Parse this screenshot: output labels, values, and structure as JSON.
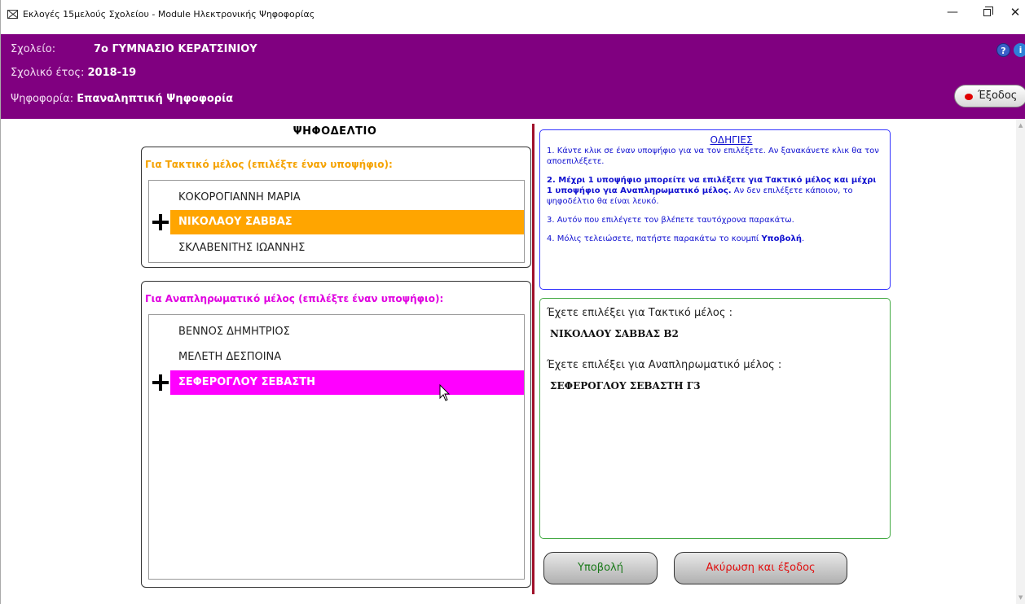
{
  "window": {
    "title": "Εκλογές 15μελούς Σχολείου - Module Ηλεκτρονικής Ψηφοφορίας",
    "minimize_icon": "minimize-icon",
    "maximize_icon": "restore-icon",
    "close_icon": "close-icon"
  },
  "header": {
    "school_label": "Σχολείο:",
    "school_value": "7ο ΓΥΜΝΑΣΙΟ ΚΕΡΑΤΣΙΝΙΟΥ",
    "year_label": "Σχολικό έτος:",
    "year_value": "2018-19",
    "vote_label": "Ψηφοφορία:",
    "vote_value": "Επαναληπτική Ψηφοφορία",
    "help_glyph": "?",
    "info_glyph": "i",
    "exit_label": "Έξοδος",
    "background_color": "#800080"
  },
  "ballot": {
    "title": "ΨΗΦΟΔΕΛΤΙΟ",
    "regular": {
      "heading": "Για Τακτικό μέλος (επιλέξτε έναν υποψήφιο):",
      "heading_color": "#f5a200",
      "selected_color": "#ffa500",
      "candidates": [
        "ΚΟΚΟΡΟΓΙΑΝΝΗ ΜΑΡΙΑ",
        "ΝΙΚΟΛΑΟΥ ΣΑΒΒΑΣ",
        "ΣΚΛΑΒΕΝΙΤΗΣ ΙΩΑΝΝΗΣ"
      ],
      "selected_index": 1
    },
    "substitute": {
      "heading": "Για Αναπληρωματικό μέλος (επιλέξτε έναν υποψήφιο):",
      "heading_color": "#e000e0",
      "selected_color": "#ff00ff",
      "candidates": [
        "ΒΕΝΝΟΣ ΔΗΜΗΤΡΙΟΣ",
        "ΜΕΛΕΤΗ ΔΕΣΠΟΙΝΑ",
        "ΣΕΦΕΡΟΓΛΟΥ ΣΕΒΑΣΤΗ"
      ],
      "selected_index": 2
    }
  },
  "instructions": {
    "title": "ΟΔΗΓΙΕΣ",
    "p1": "1. Κάντε κλικ σε έναν υποψήφιο για να τον επιλέξετε. Αν ξανακάνετε κλικ θα τον αποεπιλέξετε.",
    "p2_bold": "2. Μέχρι 1 υποψήφιο μπορείτε να επιλέξετε για Τακτικό μέλος και μέχρι 1 υποψήφιο για Αναπληρωματικό μέλος.",
    "p2_rest": " Αν δεν επιλέξετε κάποιον, το ψηφοδέλτιο θα είναι λευκό.",
    "p3": "3. Αυτόν που επιλέγετε τον βλέπετε ταυτόχρονα παρακάτω.",
    "p4_pre": "4. Μόλις τελειώσετε, πατήστε παρακάτω το κουμπί ",
    "p4_bold": "Υποβολή",
    "p4_post": ".",
    "color": "#1010d0"
  },
  "summary": {
    "regular_label": "Έχετε επιλέξει για Τακτικό μέλος :",
    "regular_value": "ΝΙΚΟΛΑΟΥ ΣΑΒΒΑΣ Β2",
    "substitute_label": "Έχετε επιλέξει για Αναπληρωματικό μέλος :",
    "substitute_value": "ΣΕΦΕΡΟΓΛΟΥ ΣΕΒΑΣΤΗ Γ3"
  },
  "actions": {
    "submit_label": "Υποβολή",
    "cancel_label": "Ακύρωση και έξοδος",
    "submit_color": "#1a7a1a",
    "cancel_color": "#e01010"
  }
}
